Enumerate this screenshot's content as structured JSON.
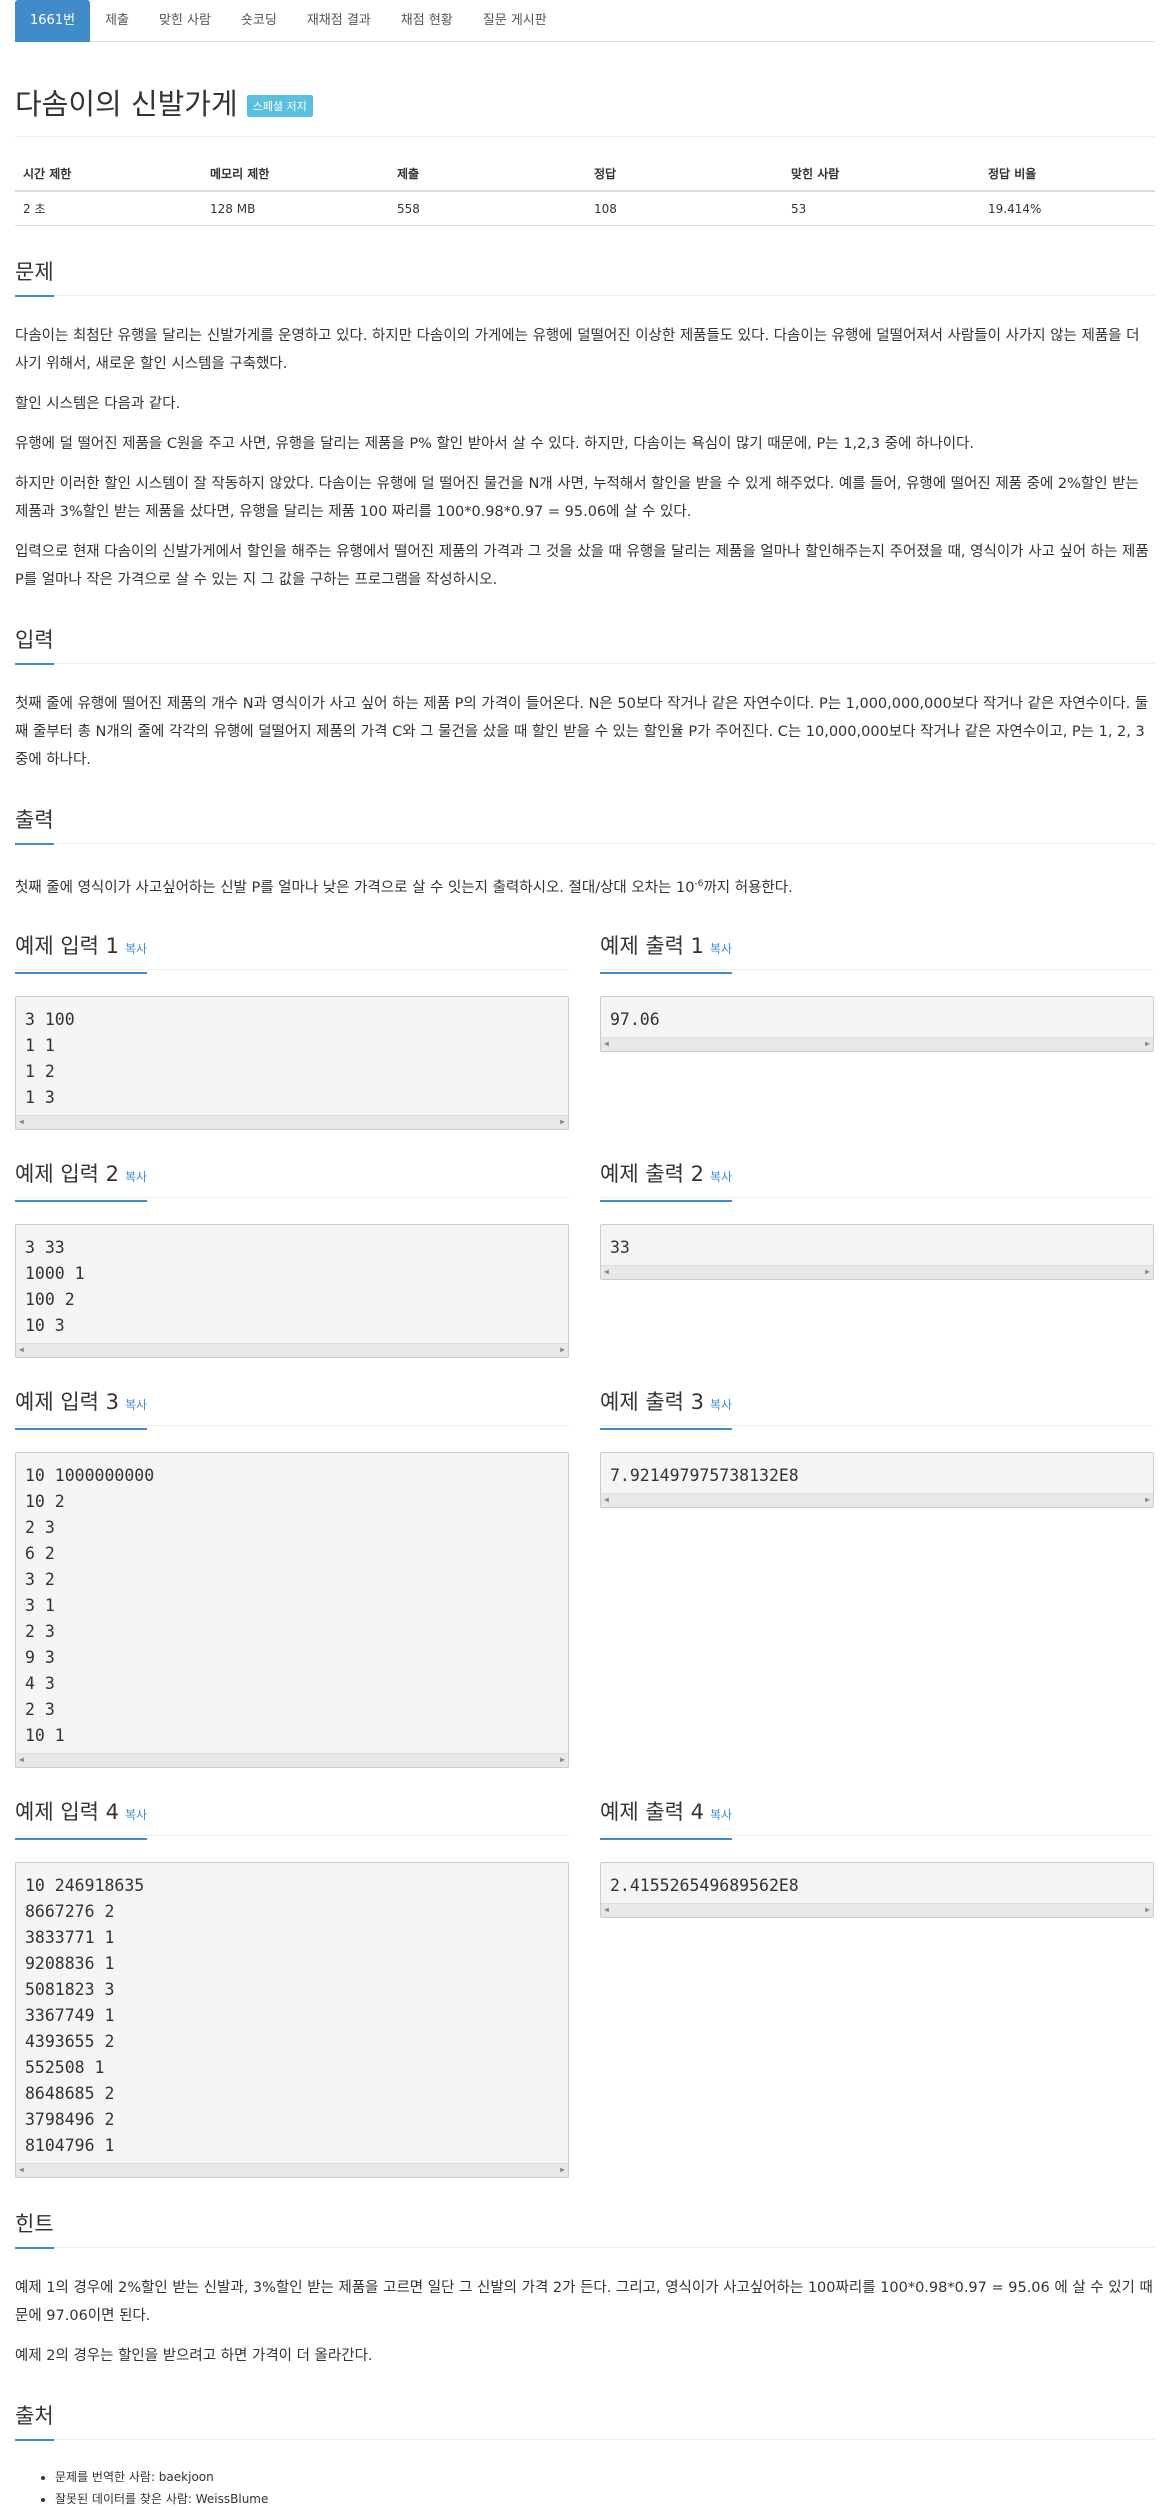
{
  "tabs": [
    {
      "label": "1661번"
    },
    {
      "label": "제출"
    },
    {
      "label": "맞힌 사람"
    },
    {
      "label": "숏코딩"
    },
    {
      "label": "재채점 결과"
    },
    {
      "label": "채점 현황"
    },
    {
      "label": "질문 게시판"
    }
  ],
  "problem": {
    "title": "다솜이의 신발가게",
    "badge": "스페셜 저지"
  },
  "info": {
    "headers": [
      "시간 제한",
      "메모리 제한",
      "제출",
      "정답",
      "맞힌 사람",
      "정답 비율"
    ],
    "values": [
      "2 초",
      "128 MB",
      "558",
      "108",
      "53",
      "19.414%"
    ]
  },
  "sections": {
    "problem_heading": "문제",
    "problem_paragraphs": [
      "다솜이는 최첨단 유행을 달리는 신발가게를 운영하고 있다. 하지만 다솜이의 가게에는 유행에 덜떨어진 이상한 제품들도 있다. 다솜이는 유행에 덜떨어져서 사람들이 사가지 않는 제품을 더 사기 위해서, 새로운 할인 시스템을 구축했다.",
      "할인 시스템은 다음과 같다.",
      "유행에 덜 떨어진 제품을 C원을 주고 사면, 유행을 달리는 제품을 P% 할인 받아서 살 수 있다. 하지만, 다솜이는 욕심이 많기 때문에, P는 1,2,3 중에 하나이다.",
      "하지만 이러한 할인 시스템이 잘 작동하지 않았다. 다솜이는 유행에 덜 떨어진 물건을 N개 사면, 누적해서 할인을 받을 수 있게 해주었다. 예를 들어, 유행에 떨어진 제품 중에 2%할인 받는 제품과 3%할인 받는 제품을 샀다면, 유행을 달리는 제품 100 짜리를 100*0.98*0.97 = 95.06에 살 수 있다.",
      "입력으로 현재 다솜이의 신발가게에서 할인을 해주는 유행에서 떨어진 제품의 가격과 그 것을 샀을 때 유행을 달리는 제품을 얼마나 할인해주는지 주어졌을 때, 영식이가 사고 싶어 하는 제품 P를 얼마나 작은 가격으로 살 수 있는 지 그 값을 구하는 프로그램을 작성하시오."
    ],
    "input_heading": "입력",
    "input_paragraph": "첫째 줄에 유행에 떨어진 제품의 개수 N과 영식이가 사고 싶어 하는 제품 P의 가격이 들어온다. N은 50보다 작거나 같은 자연수이다. P는 1,000,000,000보다 작거나 같은 자연수이다. 둘째 줄부터 총 N개의 줄에 각각의 유행에 덜떨어지 제품의 가격 C와 그 물건을 샀을 때 할인 받을 수 있는 할인율 P가 주어진다. C는 10,000,000보다 작거나 같은 자연수이고, P는 1, 2, 3 중에 하나다.",
    "output_heading": "출력",
    "output_text_before": "첫째 줄에 영식이가 사고싶어하는 신발 P를 얼마나 낮은 가격으로 살 수 잇는지 출력하시오. 절대/상대 오차는 10",
    "output_sup": "-6",
    "output_text_after": "까지 허용한다.",
    "hint_heading": "힌트",
    "hint_paragraphs": [
      "예제 1의 경우에 2%할인 받는 신발과, 3%할인 받는 제품을 고르면 일단 그 신발의 가격 2가 든다. 그리고, 영식이가 사고싶어하는 100짜리를 100*0.98*0.97 = 95.06 에 살 수 있기 때문에 97.06이면 된다.",
      "예제 2의 경우는 할인을 받으려고 하면 가격이 더 올라간다."
    ],
    "source_heading": "출처",
    "sources": [
      "문제를 번역한 사람: baekjoon",
      "잘못된 데이터를 찾은 사람: WeissBlume"
    ]
  },
  "copy_label": "복사",
  "samples": [
    {
      "in_title": "예제 입력 1",
      "out_title": "예제 출력 1",
      "input": [
        "3 100",
        "1 1",
        "1 2",
        "1 3"
      ],
      "output": [
        "97.06"
      ]
    },
    {
      "in_title": "예제 입력 2",
      "out_title": "예제 출력 2",
      "input": [
        "3 33",
        "1000 1",
        "100 2",
        "10 3"
      ],
      "output": [
        "33"
      ]
    },
    {
      "in_title": "예제 입력 3",
      "out_title": "예제 출력 3",
      "input": [
        "10 1000000000",
        "10 2",
        "2 3",
        "6 2",
        "3 2",
        "3 1",
        "2 3",
        "9 3",
        "4 3",
        "2 3",
        "10 1"
      ],
      "output": [
        "7.921497975738132E8"
      ]
    },
    {
      "in_title": "예제 입력 4",
      "out_title": "예제 출력 4",
      "input": [
        "10 246918635",
        "8667276 2",
        "3833771 1",
        "9208836 1",
        "5081823 3",
        "3367749 1",
        "4393655 2",
        "552508 1",
        "8648685 2",
        "3798496 2",
        "8104796 1"
      ],
      "output": [
        "2.415526549689562E8"
      ]
    }
  ]
}
